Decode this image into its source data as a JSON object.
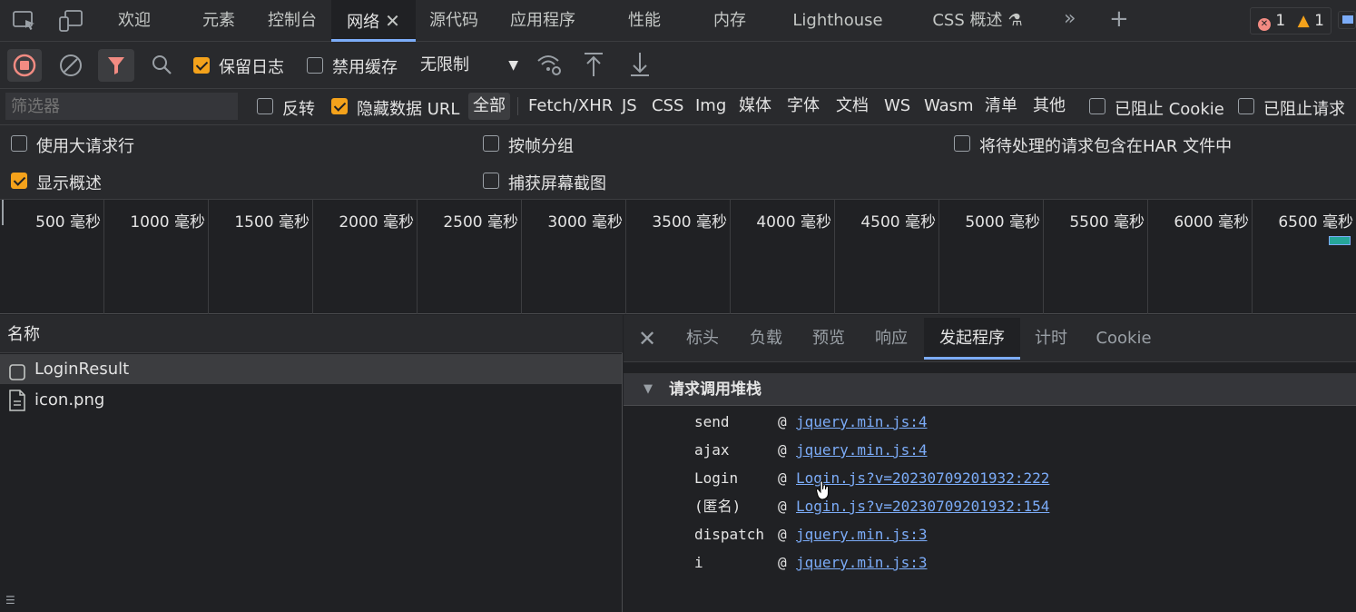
{
  "tabs": [
    {
      "label": "欢迎"
    },
    {
      "label": "元素"
    },
    {
      "label": "控制台"
    },
    {
      "label": "网络",
      "active": true
    },
    {
      "label": "源代码"
    },
    {
      "label": "应用程序"
    },
    {
      "label": "性能"
    },
    {
      "label": "内存"
    },
    {
      "label": "Lighthouse"
    },
    {
      "label": "CSS 概述"
    }
  ],
  "status": {
    "errors": "1",
    "warnings": "1"
  },
  "toolbar": {
    "preserve_log": "保留日志",
    "disable_cache": "禁用缓存",
    "throttle": "无限制"
  },
  "filter": {
    "placeholder": "筛选器",
    "invert": "反转",
    "hide_data_url": "隐藏数据 URL",
    "types": [
      "全部",
      "Fetch/XHR",
      "JS",
      "CSS",
      "Img",
      "媒体",
      "字体",
      "文档",
      "WS",
      "Wasm",
      "清单",
      "其他"
    ],
    "blocked_cookie": "已阻止 Cookie",
    "blocked_requests": "已阻止请求"
  },
  "options": {
    "large_rows": "使用大请求行",
    "group_by_frame": "按帧分组",
    "har_pending": "将待处理的请求包含在HAR 文件中",
    "show_overview": "显示概述",
    "capture_screenshots": "捕获屏幕截图"
  },
  "timeline": {
    "ticks": [
      "500 毫秒",
      "1000 毫秒",
      "1500 毫秒",
      "2000 毫秒",
      "2500 毫秒",
      "3000 毫秒",
      "3500 毫秒",
      "4000 毫秒",
      "4500 毫秒",
      "5000 毫秒",
      "5500 毫秒",
      "6000 毫秒",
      "6500 毫秒"
    ]
  },
  "requests": {
    "column_name": "名称",
    "items": [
      "LoginResult",
      "icon.png"
    ]
  },
  "detail": {
    "tabs": [
      "标头",
      "负载",
      "预览",
      "响应",
      "发起程序",
      "计时",
      "Cookie"
    ],
    "active_tab": "发起程序",
    "stack_title": "请求调用堆栈",
    "frames": [
      {
        "fn": "send",
        "at": "@",
        "src": "jquery.min.js:4"
      },
      {
        "fn": "ajax",
        "at": "@",
        "src": "jquery.min.js:4"
      },
      {
        "fn": "Login",
        "at": "@",
        "src": "Login.js?v=20230709201932:222"
      },
      {
        "fn": "(匿名)",
        "at": "@",
        "src": "Login.js?v=20230709201932:154"
      },
      {
        "fn": "dispatch",
        "at": "@",
        "src": "jquery.min.js:3"
      },
      {
        "fn": "i",
        "at": "@",
        "src": "jquery.min.js:3"
      }
    ]
  },
  "colors": {
    "accent": "#7cacf8",
    "checkbox": "#f4a21b",
    "record": "#f28b82"
  }
}
